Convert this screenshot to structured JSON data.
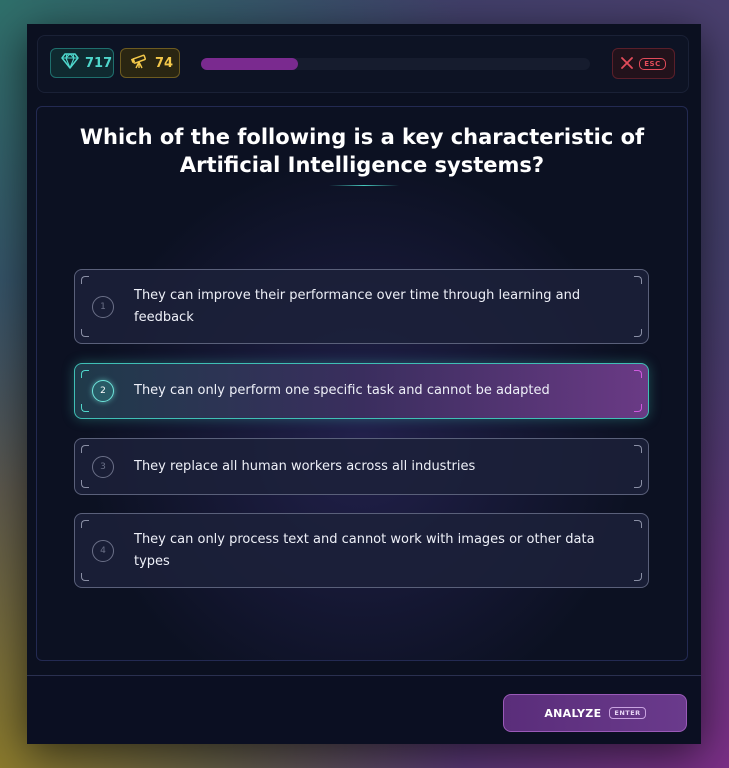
{
  "stats": {
    "gems": "717",
    "gems_icon": "diamond-icon",
    "telescope": "74",
    "telescope_icon": "telescope-icon"
  },
  "progress": {
    "fraction": 0.25,
    "color": "#7a2a8f"
  },
  "close": {
    "icon": "close-x-icon",
    "shortcut": "ESC"
  },
  "question": {
    "text": "Which of the following is a key characteristic of Artificial Intelligence systems?"
  },
  "options": [
    {
      "number": "1",
      "text": "They can improve their performance over time through learning and feedback",
      "selected": false
    },
    {
      "number": "2",
      "text": "They can only perform one specific task and cannot be adapted",
      "selected": true
    },
    {
      "number": "3",
      "text": "They replace all human workers across all industries",
      "selected": false
    },
    {
      "number": "4",
      "text": "They can only process text and cannot work with images or other data types",
      "selected": false
    }
  ],
  "footer": {
    "button_label": "ANALYZE",
    "shortcut": "ENTER"
  },
  "colors": {
    "accent_teal": "#3fbfb5",
    "accent_purple": "#7a2a8f",
    "danger": "#e24b5a",
    "gold": "#f3c84a"
  }
}
